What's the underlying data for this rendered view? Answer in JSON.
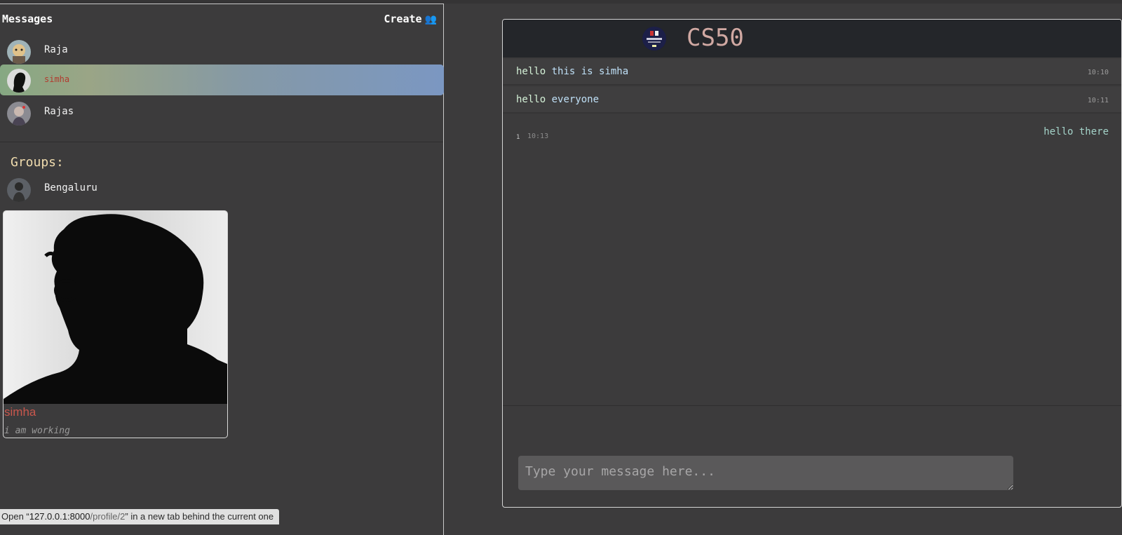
{
  "sidebar": {
    "title": "Messages",
    "create_label": "Create",
    "create_icon": "people-icon",
    "contacts": [
      {
        "name": "Raja"
      },
      {
        "name": "simha"
      },
      {
        "name": "Rajas"
      }
    ],
    "selected_index": 1,
    "groups_title": "Groups:",
    "groups": [
      {
        "name": "Bengaluru"
      }
    ]
  },
  "profile_card": {
    "name": "simha",
    "status": "i am working"
  },
  "status_bar": {
    "text_prefix": "Open “",
    "host": "127.0.0.1:8000",
    "path": "/profile/2",
    "text_suffix": "” in a new tab behind the current one"
  },
  "chat": {
    "title": "CS50",
    "messages": [
      {
        "text_first": "hello",
        "text_rest": " this is simha",
        "time": "10:10"
      },
      {
        "text_first": "hello",
        "text_rest": " everyone",
        "time": "10:11"
      }
    ],
    "sent_message": {
      "text": "hello there",
      "count": "1",
      "time": "10:13"
    },
    "input_placeholder": "Type your message here..."
  },
  "colors": {
    "background": "#3c3b3c",
    "selected_gradient_start": "#86a883",
    "selected_gradient_end": "#7b97c2",
    "header_bg": "#24262a",
    "title_color": "#d1a9a3",
    "groups_title_color": "#f0dcae"
  }
}
